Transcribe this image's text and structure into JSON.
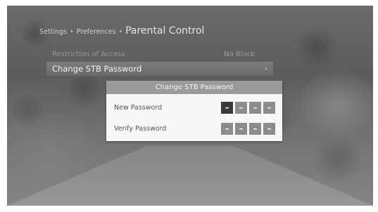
{
  "breadcrumb": {
    "level1": "Settings",
    "level2": "Preferences",
    "separator": "•",
    "current": "Parental Control"
  },
  "menu": {
    "items": [
      {
        "label": "Restriction of Access",
        "value": "No Block"
      },
      {
        "label": "Change STB Password",
        "chevron": "›"
      }
    ]
  },
  "dialog": {
    "title": "Change STB Password",
    "fields": [
      {
        "label": "New Password",
        "digits": [
          "–",
          "–",
          "–",
          "–"
        ],
        "active_digit": 0
      },
      {
        "label": "Verify Password",
        "digits": [
          "–",
          "–",
          "–",
          "–"
        ]
      }
    ]
  },
  "colors": {
    "menu_highlight": "#757575",
    "dialog_header": "#9a9a9a",
    "pin_active": "#3a3a3a",
    "pin_inactive": "#8c8c8c"
  }
}
